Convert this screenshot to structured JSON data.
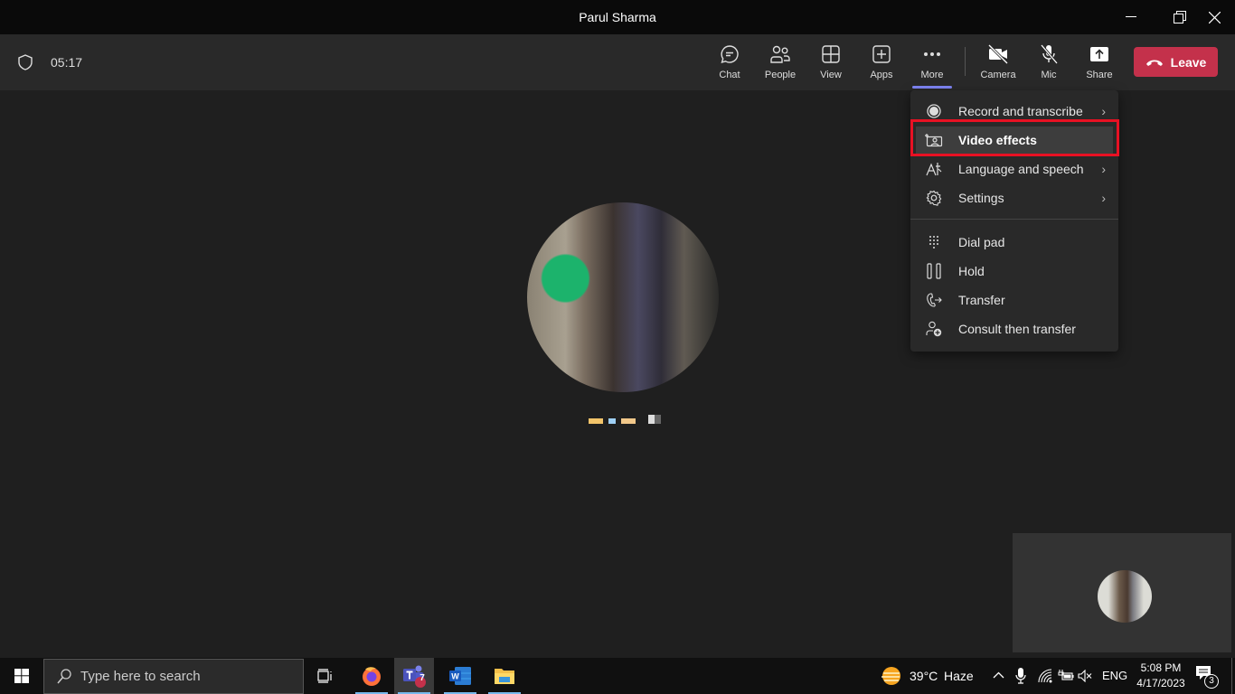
{
  "window": {
    "title": "Parul Sharma"
  },
  "call": {
    "timer": "05:17"
  },
  "toolbar": {
    "chat": "Chat",
    "people": "People",
    "view": "View",
    "apps": "Apps",
    "more": "More",
    "camera": "Camera",
    "mic": "Mic",
    "share": "Share",
    "leave": "Leave",
    "accent": "#7f85f5",
    "leave_color": "#c4314b"
  },
  "more_menu": {
    "items": [
      {
        "label": "Record and transcribe",
        "icon": "record-icon",
        "submenu": true
      },
      {
        "label": "Video effects",
        "icon": "video-effects-icon",
        "submenu": false,
        "highlighted": true
      },
      {
        "label": "Language and speech",
        "icon": "language-icon",
        "submenu": true
      },
      {
        "label": "Settings",
        "icon": "gear-icon",
        "submenu": true
      },
      {
        "label": "Dial pad",
        "icon": "dialpad-icon",
        "submenu": false
      },
      {
        "label": "Hold",
        "icon": "hold-icon",
        "submenu": false
      },
      {
        "label": "Transfer",
        "icon": "transfer-icon",
        "submenu": false
      },
      {
        "label": "Consult then transfer",
        "icon": "consult-transfer-icon",
        "submenu": false
      }
    ],
    "chevron": "›",
    "highlight_color": "#e81123"
  },
  "taskbar": {
    "search_placeholder": "Type here to search",
    "teams_badge": "7",
    "weather_temp": "39°C",
    "weather_desc": "Haze",
    "language": "ENG",
    "time": "5:08 PM",
    "date": "4/17/2023",
    "notifications": "3"
  }
}
